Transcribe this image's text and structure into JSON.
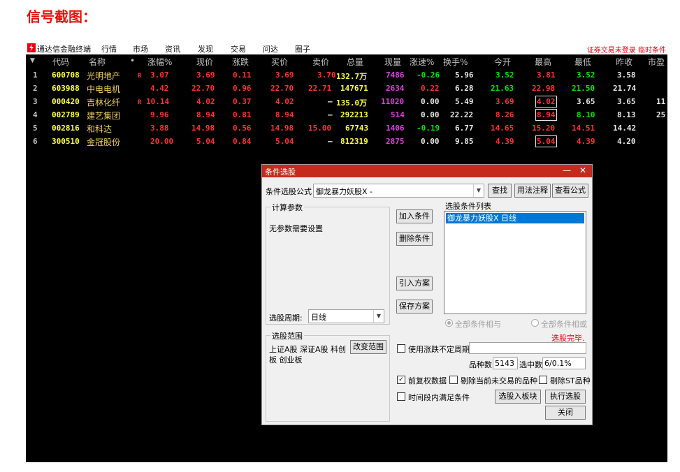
{
  "heading": "信号截图：",
  "menubar": {
    "app_name": "通达信金融终端",
    "items": [
      "行情",
      "市场",
      "资讯",
      "发现",
      "交易",
      "问达",
      "圈子"
    ],
    "status": "证券交易未登录  临时条件"
  },
  "columns": [
    "代码",
    "名称",
    "•",
    "涨幅%",
    "现价",
    "涨跌",
    "买价",
    "卖价",
    "总量",
    "现量",
    "涨速%",
    "换手%",
    "今开",
    "最高",
    "最低",
    "昨收",
    "市盈"
  ],
  "rows": [
    {
      "num": "1",
      "code": "600708",
      "name": "光明地产",
      "flag": "R",
      "change_pct": "3.07",
      "price": "3.69",
      "change": "0.11",
      "bid": "3.69",
      "ask": "3.70",
      "volume": "132.7万",
      "cur_vol": "7486",
      "speed": "-0.26",
      "turnover": "5.96",
      "open": "3.52",
      "high": "3.81",
      "low": "3.52",
      "prev_close": "3.58",
      "pe": ""
    },
    {
      "num": "2",
      "code": "603988",
      "name": "中电电机",
      "flag": "",
      "change_pct": "4.42",
      "price": "22.70",
      "change": "0.96",
      "bid": "22.70",
      "ask": "22.71",
      "volume": "147671",
      "cur_vol": "2634",
      "speed": "0.22",
      "turnover": "6.28",
      "open": "21.63",
      "high": "22.98",
      "low": "21.50",
      "prev_close": "21.74",
      "pe": ""
    },
    {
      "num": "3",
      "code": "000420",
      "name": "吉林化纤",
      "flag": "R",
      "change_pct": "10.14",
      "price": "4.02",
      "change": "0.37",
      "bid": "4.02",
      "ask": "–",
      "volume": "135.0万",
      "cur_vol": "11020",
      "speed": "0.00",
      "turnover": "5.49",
      "open": "3.69",
      "high": "4.02",
      "low": "3.65",
      "prev_close": "3.65",
      "pe": "11"
    },
    {
      "num": "4",
      "code": "002789",
      "name": "建艺集团",
      "flag": "",
      "change_pct": "9.96",
      "price": "8.94",
      "change": "0.81",
      "bid": "8.94",
      "ask": "–",
      "volume": "292213",
      "cur_vol": "514",
      "speed": "0.00",
      "turnover": "22.22",
      "open": "8.26",
      "high": "8.94",
      "low": "8.10",
      "prev_close": "8.13",
      "pe": "25"
    },
    {
      "num": "5",
      "code": "002816",
      "name": "和科达",
      "flag": "",
      "change_pct": "3.88",
      "price": "14.98",
      "change": "0.56",
      "bid": "14.98",
      "ask": "15.00",
      "volume": "67743",
      "cur_vol": "1406",
      "speed": "-0.19",
      "turnover": "6.77",
      "open": "14.65",
      "high": "15.20",
      "low": "14.51",
      "prev_close": "14.42",
      "pe": ""
    },
    {
      "num": "6",
      "code": "300510",
      "name": "金冠股份",
      "flag": "",
      "change_pct": "20.00",
      "price": "5.04",
      "change": "0.84",
      "bid": "5.04",
      "ask": "–",
      "volume": "812319",
      "cur_vol": "2875",
      "speed": "0.00",
      "turnover": "9.85",
      "open": "4.39",
      "high": "5.04",
      "low": "4.39",
      "prev_close": "4.20",
      "pe": ""
    }
  ],
  "colors": {
    "up": "#ff3232",
    "down": "#00e600",
    "flat": "#e6e6e6",
    "title_bar": "#c42b1c",
    "selection": "#0078d7"
  },
  "dialog": {
    "title": "条件选股",
    "window_controls": "— ✕",
    "formula_label": "条件选股公式",
    "formula_value": "御龙暴力妖股X -",
    "find_btn": "查找",
    "usage_btn": "用法注释",
    "view_btn": "查看公式",
    "calc_params_title": "计算参数",
    "no_params": "无参数需要设置",
    "period_label": "选股周期:",
    "period_value": "日线",
    "add_btn": "加入条件",
    "delete_btn": "删除条件",
    "import_btn": "引入方案",
    "save_btn": "保存方案",
    "cond_list_title": "选股条件列表",
    "cond_items": [
      "御龙暴力妖股X  日线"
    ],
    "radio_and": "全部条件相与",
    "radio_or": "全部条件相或",
    "done_text": "选股完毕.",
    "range_title": "选股范围",
    "range_text": "上证A股 深证A股 科创板 创业板",
    "change_range_btn": "改变范围",
    "use_period_label": "使用涨跌不定周期",
    "count_label": "品种数",
    "count_value": "5143",
    "selected_label": "选中数",
    "selected_value": "6/0.1%",
    "adj_label": "前复权数据",
    "remove_untraded_label": "剔除当前未交易的品种",
    "remove_st_label": "剔除ST品种",
    "time_cond_label": "时间段内满足条件",
    "to_block_btn": "选股入板块",
    "execute_btn": "执行选股",
    "close_btn": "关闭"
  }
}
